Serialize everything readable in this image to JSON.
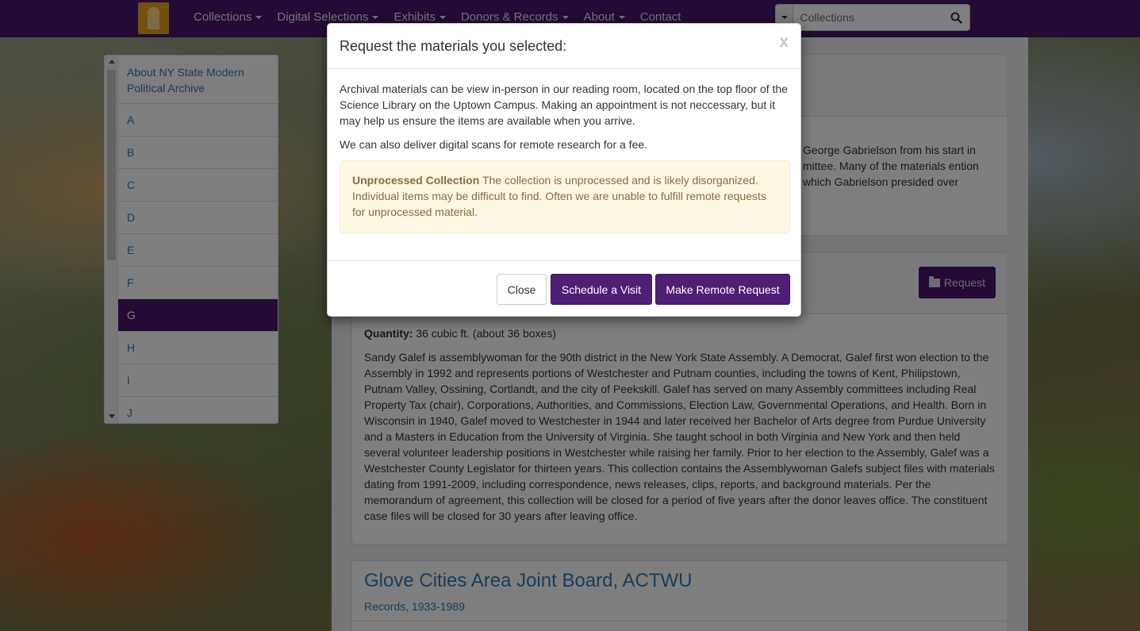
{
  "nav": {
    "items": [
      {
        "label": "Collections",
        "caret": true
      },
      {
        "label": "Digital Selections",
        "caret": true
      },
      {
        "label": "Exhibits",
        "caret": true
      },
      {
        "label": "Donors & Records",
        "caret": true
      },
      {
        "label": "About",
        "caret": true
      },
      {
        "label": "Contact",
        "caret": false
      }
    ],
    "search_placeholder": "Collections"
  },
  "sidebar": {
    "items": [
      {
        "label": "About NY State Modern Political Archive"
      },
      {
        "label": "A"
      },
      {
        "label": "B"
      },
      {
        "label": "C"
      },
      {
        "label": "D"
      },
      {
        "label": "E"
      },
      {
        "label": "F"
      },
      {
        "label": "G",
        "active": true
      },
      {
        "label": "H"
      },
      {
        "label": "I"
      },
      {
        "label": "J"
      }
    ]
  },
  "panel1": {
    "text": "George Gabrielson from his start in mittee. Many of the materials ention which Gabrielson presided over"
  },
  "panel2": {
    "request_label": "Request",
    "quantity_label": "Quantity:",
    "quantity_value": " 36 cubic ft. (about 36 boxes)",
    "description": "Sandy Galef is assemblywoman for the 90th district in the New York State Assembly. A Democrat, Galef first won election to the Assembly in 1992 and represents portions of Westchester and Putnam counties, including the towns of Kent, Philipstown, Putnam Valley, Ossining, Cortlandt, and the city of Peekskill. Galef has served on many Assembly committees including Real Property Tax (chair), Corporations, Authorities, and Commissions, Election Law, Governmental Operations, and Health. Born in Wisconsin in 1940, Galef moved to Westchester in 1944 and later received her Bachelor of Arts degree from Purdue University and a Masters in Education from the University of Virginia. She taught school in both Virginia and New York and then held several volunteer leadership positions in Westchester while raising her family. Prior to her election to the Assembly, Galef was a Westchester County Legislator for thirteen years. This collection contains the Assemblywoman Galefs subject files with materials dating from 1991-2009, including correspondence, news releases, clips, reports, and background materials. Per the memorandum of agreement, this collection will be closed for a period of five years after the donor leaves office. The constituent case files will be closed for 30 years after leaving office."
  },
  "panel3": {
    "title": "Glove Cities Area Joint Board, ACTWU",
    "subtitle": "Records, 1933-1989"
  },
  "modal": {
    "title": "Request the materials you selected:",
    "close_x": "x",
    "para1": "Archival materials can be view in-person in our reading room, located on the top floor of the Science Library on the Uptown Campus. Making an appointment is not neccessary, but it may help us ensure the items are available when you arrive.",
    "para2": "We can also deliver digital scans for remote research for a fee.",
    "alert_title": "Unprocessed Collection",
    "alert_text": " The collection is unprocessed and is likely disorganized. Individual items may be difficult to find. Often we are unable to fulfill remote requests for unprocessed material.",
    "close_label": "Close",
    "visit_label": "Schedule a Visit",
    "remote_label": "Make Remote Request"
  },
  "colors": {
    "brand_purple": "#46166b",
    "link_blue": "#337ab7",
    "alert_bg": "#fcf8e3",
    "alert_text": "#8a6d3b"
  }
}
